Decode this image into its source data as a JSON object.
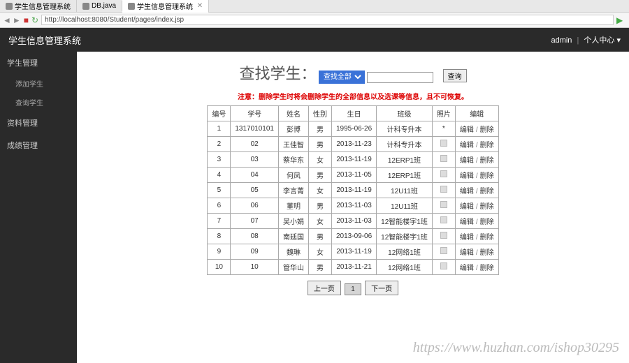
{
  "browser": {
    "tabs": [
      {
        "label": "学生信息管理系统"
      },
      {
        "label": "DB.java"
      },
      {
        "label": "学生信息管理系统"
      }
    ],
    "url": "http://localhost:8080/Student/pages/index.jsp"
  },
  "header": {
    "title": "学生信息管理系统",
    "user": "admin",
    "user_menu": "个人中心"
  },
  "sidebar": {
    "items": [
      {
        "label": "学生管理",
        "sub": [
          {
            "label": "添加学生"
          },
          {
            "label": "查询学生"
          }
        ]
      },
      {
        "label": "资料管理",
        "sub": []
      },
      {
        "label": "成绩管理",
        "sub": []
      }
    ]
  },
  "search": {
    "label": "查找学生：",
    "select_value": "查找全部",
    "input_value": "",
    "button_label": "查询"
  },
  "warning_text": "注意：删除学生时将会删除学生的全部信息以及选课等信息，且不可恢复。",
  "table": {
    "headers": [
      "编号",
      "学号",
      "姓名",
      "性别",
      "生日",
      "班级",
      "照片",
      "编辑"
    ],
    "rows": [
      {
        "idx": "1",
        "sno": "1317010101",
        "name": "彭博",
        "sex": "男",
        "bd": "1995-06-26",
        "cls": "计科专升本",
        "photo": "*"
      },
      {
        "idx": "2",
        "sno": "02",
        "name": "王佳智",
        "sex": "男",
        "bd": "2013-11-23",
        "cls": "计科专升本",
        "photo": ""
      },
      {
        "idx": "3",
        "sno": "03",
        "name": "蔡华东",
        "sex": "女",
        "bd": "2013-11-19",
        "cls": "12ERP1班",
        "photo": ""
      },
      {
        "idx": "4",
        "sno": "04",
        "name": "何凤",
        "sex": "男",
        "bd": "2013-11-05",
        "cls": "12ERP1班",
        "photo": ""
      },
      {
        "idx": "5",
        "sno": "05",
        "name": "李言菁",
        "sex": "女",
        "bd": "2013-11-19",
        "cls": "12U11班",
        "photo": ""
      },
      {
        "idx": "6",
        "sno": "06",
        "name": "董明",
        "sex": "男",
        "bd": "2013-11-03",
        "cls": "12U11班",
        "photo": ""
      },
      {
        "idx": "7",
        "sno": "07",
        "name": "吴小娟",
        "sex": "女",
        "bd": "2013-11-03",
        "cls": "12智能楼宇1班",
        "photo": ""
      },
      {
        "idx": "8",
        "sno": "08",
        "name": "南廷国",
        "sex": "男",
        "bd": "2013-09-06",
        "cls": "12智能楼宇1班",
        "photo": ""
      },
      {
        "idx": "9",
        "sno": "09",
        "name": "魏琳",
        "sex": "女",
        "bd": "2013-11-19",
        "cls": "12网络1班",
        "photo": ""
      },
      {
        "idx": "10",
        "sno": "10",
        "name": "管华山",
        "sex": "男",
        "bd": "2013-11-21",
        "cls": "12网络1班",
        "photo": ""
      }
    ],
    "action_edit": "编辑",
    "action_delete": "删除"
  },
  "pager": {
    "prev": "上一页",
    "current": "1",
    "next": "下一页"
  },
  "watermark": "https://www.huzhan.com/ishop30295"
}
